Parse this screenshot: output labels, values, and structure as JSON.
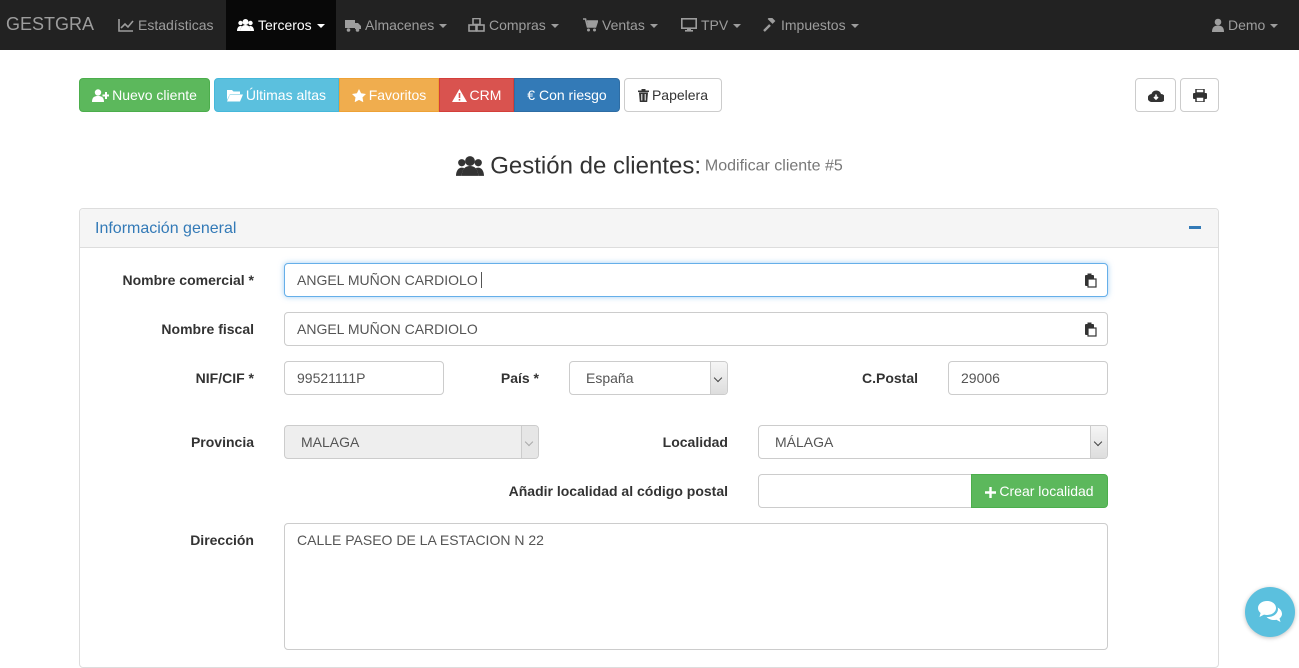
{
  "brand": "GESTGRA",
  "nav": {
    "items": [
      {
        "label": "Estadísticas",
        "icon": "line-chart-icon"
      },
      {
        "label": "Terceros",
        "icon": "users-icon"
      },
      {
        "label": "Almacenes",
        "icon": "truck-icon"
      },
      {
        "label": "Compras",
        "icon": "cubes-icon"
      },
      {
        "label": "Ventas",
        "icon": "cart-icon"
      },
      {
        "label": "TPV",
        "icon": "monitor-icon"
      },
      {
        "label": "Impuestos",
        "icon": "gavel-icon"
      }
    ],
    "active": "Terceros",
    "user": "Demo"
  },
  "toolbar": {
    "nuevo_cliente": "Nuevo cliente",
    "ultimas_altas": "Últimas altas",
    "favoritos": "Favoritos",
    "crm": "CRM",
    "con_riesgo": "Con riesgo",
    "papelera": "Papelera"
  },
  "title": {
    "main": "Gestión de clientes:",
    "sub": "Modificar cliente #5"
  },
  "panel": {
    "title": "Información general"
  },
  "form": {
    "nombre_comercial": {
      "label": "Nombre comercial *",
      "value": "ANGEL MUÑON CARDIOLO"
    },
    "nombre_fiscal": {
      "label": "Nombre fiscal",
      "value": "ANGEL MUÑON CARDIOLO"
    },
    "nif": {
      "label": "NIF/CIF *",
      "value": "99521111P"
    },
    "pais": {
      "label": "País *",
      "value": "España"
    },
    "cpostal": {
      "label": "C.Postal",
      "value": "29006"
    },
    "provincia": {
      "label": "Provincia",
      "value": "MALAGA"
    },
    "localidad": {
      "label": "Localidad",
      "value": "MÁLAGA"
    },
    "anadir_localidad": {
      "label": "Añadir localidad al código postal",
      "value": "",
      "button": "Crear localidad"
    },
    "direccion": {
      "label": "Dirección",
      "value": "CALLE PASEO DE LA ESTACION N 22"
    }
  },
  "colors": {
    "success": "#5cb85c",
    "info": "#5bc0de",
    "warning": "#f0ad4e",
    "danger": "#d9534f",
    "primary": "#337ab7"
  }
}
